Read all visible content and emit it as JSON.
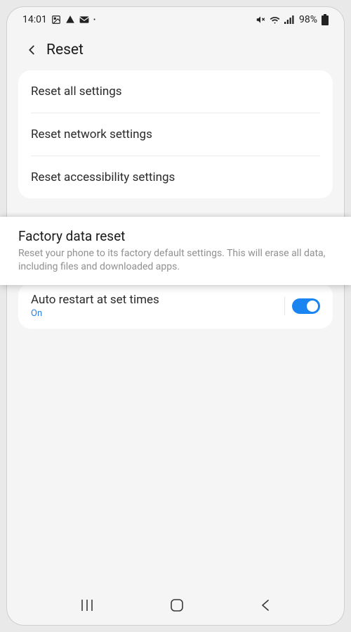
{
  "status": {
    "time": "14:01",
    "battery": "98%"
  },
  "header": {
    "title": "Reset"
  },
  "resetOptions": {
    "item0": "Reset all settings",
    "item1": "Reset network settings",
    "item2": "Reset accessibility settings"
  },
  "factory": {
    "title": "Factory data reset",
    "description": "Reset your phone to its factory default settings. This will erase all data, including files and downloaded apps."
  },
  "autoRestart": {
    "title": "Auto restart at set times",
    "status": "On",
    "enabled": true
  }
}
